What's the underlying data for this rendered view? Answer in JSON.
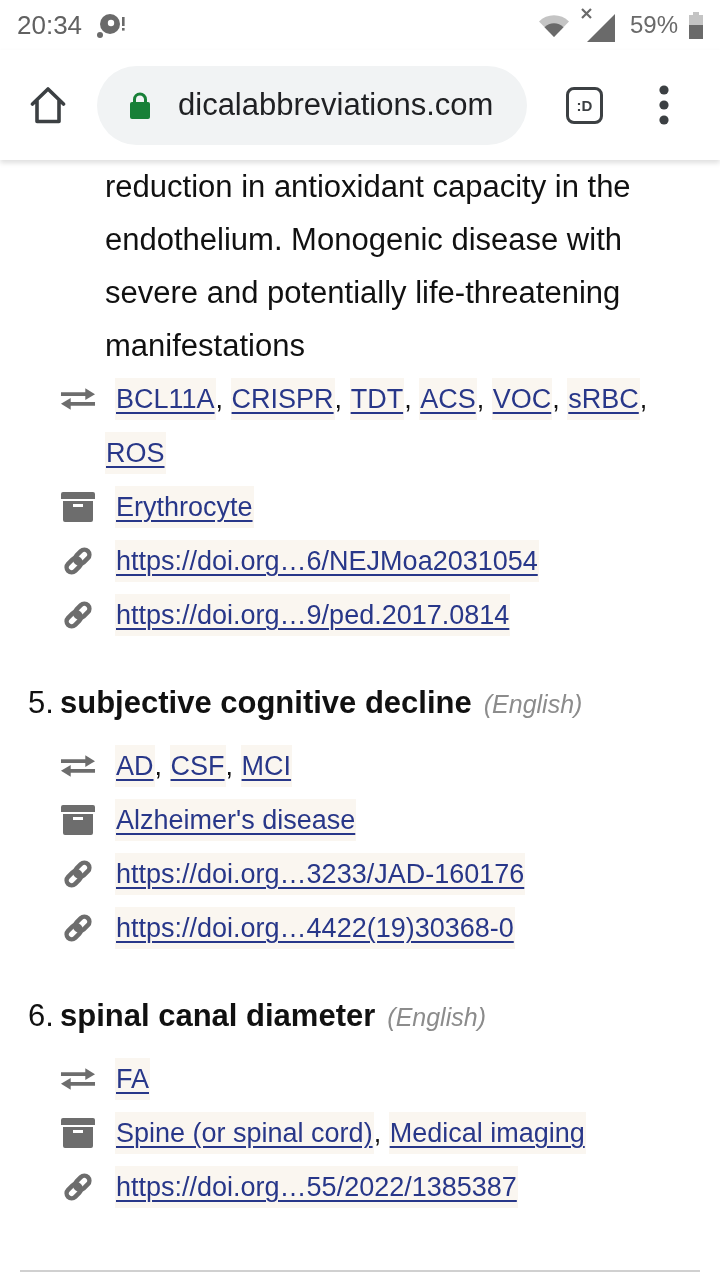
{
  "status_bar": {
    "time": "20:34",
    "battery": "59%"
  },
  "browser_toolbar": {
    "url": "dicalabbreviations.com",
    "tab_button": ":D"
  },
  "entries": [
    {
      "definition": "reduction in antioxidant capacity in the endothelium. Monogenic disease with severe and potentially life-threatening manifestations",
      "details": [
        {
          "kind": "abbreviations",
          "links": [
            {
              "text": "BCL11A",
              "trailing": ","
            },
            {
              "text": "CRISPR",
              "trailing": ","
            },
            {
              "text": "TDT",
              "trailing": ","
            },
            {
              "text": "ACS",
              "trailing": ","
            },
            {
              "text": "VOC",
              "trailing": ","
            },
            {
              "text": "sRBC",
              "trailing": ","
            },
            {
              "text": "ROS"
            }
          ]
        },
        {
          "kind": "categories",
          "links": [
            {
              "text": "Erythrocyte"
            }
          ]
        },
        {
          "kind": "references",
          "links": [
            {
              "text": "https://doi.org…6/NEJMoa2031054"
            }
          ]
        },
        {
          "kind": "references",
          "links": [
            {
              "text": "https://doi.org…9/ped.2017.0814"
            }
          ]
        }
      ]
    },
    {
      "number": "5.",
      "term": "subjective cognitive decline",
      "language": "(English)",
      "details": [
        {
          "kind": "abbreviations",
          "links": [
            {
              "text": "AD",
              "trailing": ","
            },
            {
              "text": "CSF",
              "trailing": ","
            },
            {
              "text": "MCI"
            }
          ]
        },
        {
          "kind": "categories",
          "links": [
            {
              "text": "Alzheimer's disease"
            }
          ]
        },
        {
          "kind": "references",
          "links": [
            {
              "text": "https://doi.org…3233/JAD-160176"
            }
          ]
        },
        {
          "kind": "references",
          "links": [
            {
              "text": "https://doi.org…4422(19)30368-0"
            }
          ]
        }
      ]
    },
    {
      "number": "6.",
      "term": "spinal canal diameter",
      "language": "(English)",
      "details": [
        {
          "kind": "abbreviations",
          "links": [
            {
              "text": "FA"
            }
          ]
        },
        {
          "kind": "categories",
          "links": [
            {
              "text": "Spine (or spinal cord)",
              "trailing": ","
            },
            {
              "text": "Medical imaging"
            }
          ]
        },
        {
          "kind": "references",
          "links": [
            {
              "text": "https://doi.org…55/2022/1385387"
            }
          ]
        }
      ]
    }
  ]
}
